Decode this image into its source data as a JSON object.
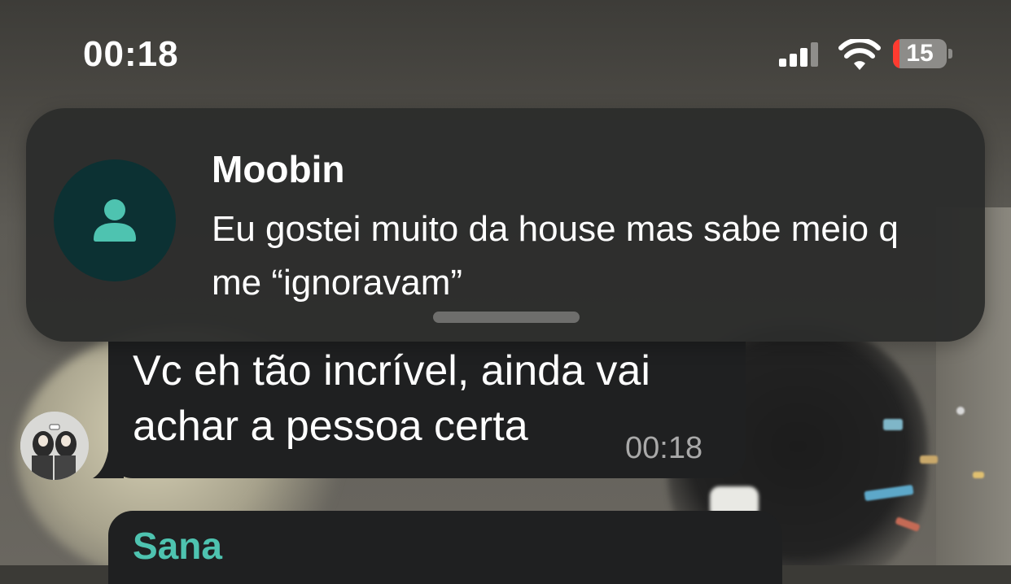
{
  "status_bar": {
    "time": "00:18",
    "battery_level": "15",
    "icons": [
      "cellular-signal-icon",
      "wifi-icon",
      "battery-icon"
    ]
  },
  "notification": {
    "sender": "Moobin",
    "message": "Eu gostei muito da house mas sabe meio q me “ignoravam”",
    "avatar_icon": "person-icon",
    "avatar_color": "#0c3133",
    "icon_color": "#4ec3b0"
  },
  "chat": {
    "messages": [
      {
        "text": "Vc eh tão incrível, ainda vai achar a pessoa certa",
        "time": "00:18"
      },
      {
        "sender": "Sana",
        "sender_color": "#4ec3b0"
      }
    ]
  }
}
